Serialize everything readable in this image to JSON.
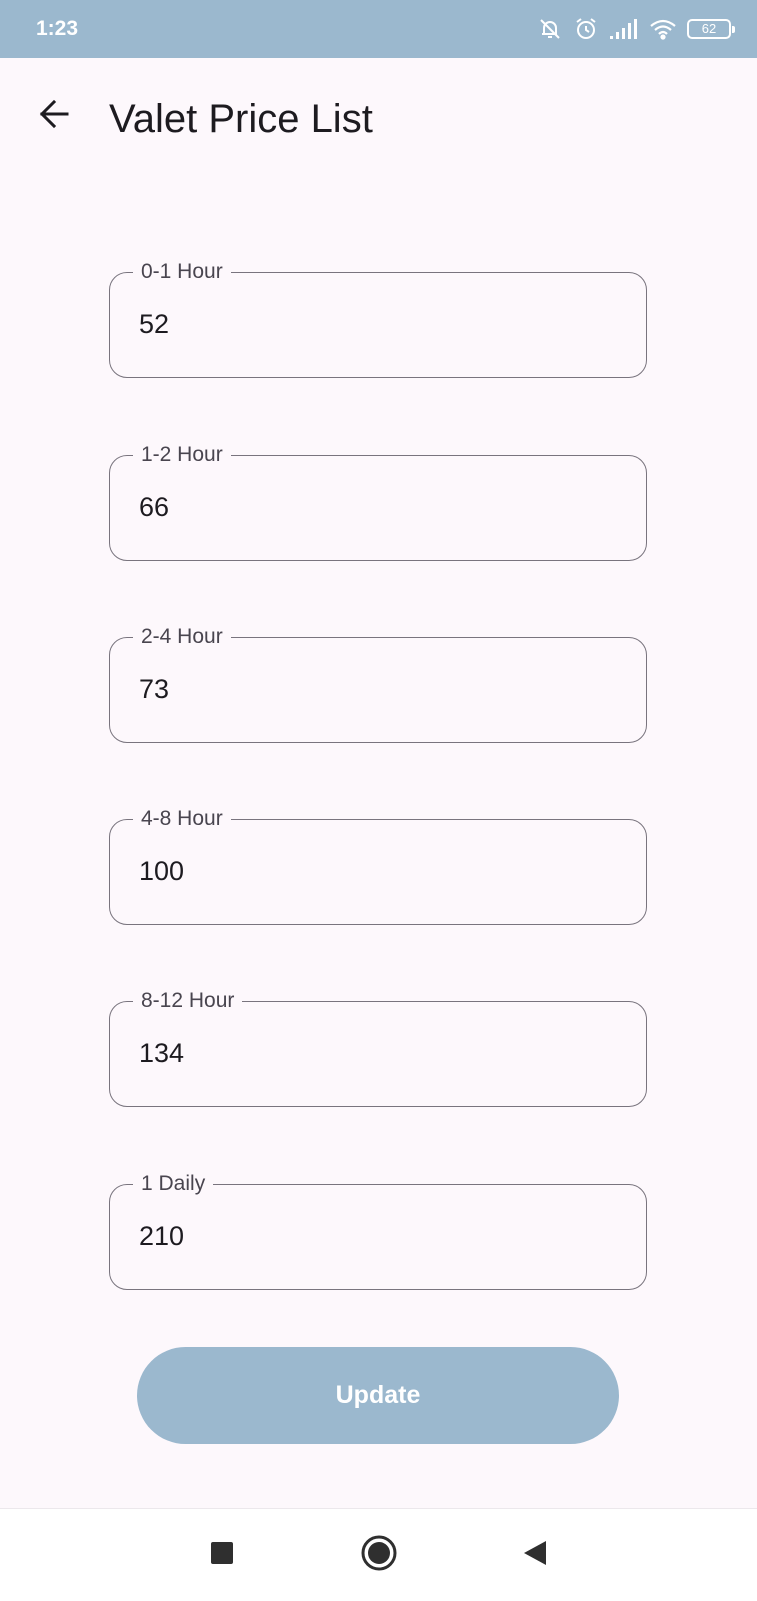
{
  "status_bar": {
    "time": "1:23",
    "battery": "62",
    "icons": [
      "bell-off-icon",
      "alarm-icon",
      "signal-icon",
      "wifi-icon",
      "battery-icon"
    ]
  },
  "app_bar": {
    "title": "Valet Price List",
    "back_icon": "arrow-left-icon"
  },
  "fields": [
    {
      "label": "0-1 Hour",
      "value": "52"
    },
    {
      "label": "1-2 Hour",
      "value": "66"
    },
    {
      "label": "2-4 Hour",
      "value": "73"
    },
    {
      "label": "4-8 Hour",
      "value": "100"
    },
    {
      "label": "8-12 Hour",
      "value": "134"
    },
    {
      "label": "1 Daily",
      "value": "210"
    }
  ],
  "update_label": "Update",
  "nav_bar": {
    "icons": [
      "recents-icon",
      "home-icon",
      "back-icon"
    ]
  },
  "colors": {
    "accent": "#9bb8ce",
    "background": "#fdf8fc",
    "outline": "#79747e",
    "text": "#1d1b20"
  }
}
